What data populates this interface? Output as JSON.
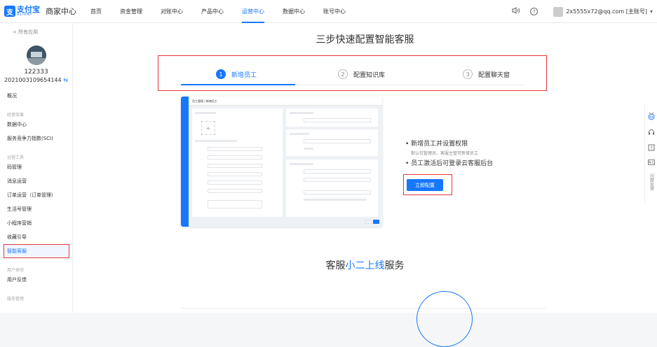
{
  "topbar": {
    "logo_mark": "支",
    "logo_name": "支付宝",
    "logo_sub": "ALIPAY",
    "app_title": "商家中心",
    "nav": [
      "首页",
      "资金管理",
      "对账中心",
      "产品中心",
      "运营中心",
      "数据中心",
      "账号中心"
    ],
    "active_nav": "运营中心",
    "user_label": "2x5555x72@qq.com [主账号]",
    "caret": "▾"
  },
  "sidebar": {
    "back_label": "< 所有应用",
    "account_name": "122333",
    "account_id": "2021003109654144",
    "swap_icon": "⇆",
    "items": [
      {
        "type": "item",
        "label": "概况"
      },
      {
        "type": "group",
        "label": "经营效果"
      },
      {
        "type": "item",
        "label": "数据中心"
      },
      {
        "type": "item",
        "label": "服务竞争力指数(SCI)"
      },
      {
        "type": "group",
        "label": "运营工具"
      },
      {
        "type": "item",
        "label": "码管理"
      },
      {
        "type": "item",
        "label": "消息运营"
      },
      {
        "type": "item",
        "label": "订单运营（订单管理）"
      },
      {
        "type": "item",
        "label": "生活号管理"
      },
      {
        "type": "item",
        "label": "小程序营销"
      },
      {
        "type": "item",
        "label": "收藏引导"
      },
      {
        "type": "item",
        "label": "智能客服",
        "active": true
      },
      {
        "type": "group",
        "label": "用户体验"
      },
      {
        "type": "item",
        "label": "用户反馈"
      },
      {
        "type": "group",
        "label": "服务管理"
      }
    ]
  },
  "main": {
    "title": "三步快速配置智能客服",
    "steps": [
      {
        "num": "1",
        "label": "新增员工",
        "active": true
      },
      {
        "num": "2",
        "label": "配置知识库",
        "active": false
      },
      {
        "num": "3",
        "label": "配置聊天窗",
        "active": false
      }
    ],
    "preview_breadcrumb": "员工管理 / 新增员工",
    "bullet_1": "• 新增员工并设置权限",
    "bullet_1_sub": "默认仅管理员、客服主管可新增员工",
    "bullet_2": "• 员工激活后可登录云客服后台",
    "config_button": "立即配置",
    "section2_prefix": "客服",
    "section2_highlight": "小二上线",
    "section2_suffix": "服务"
  },
  "float_bar": {
    "feedback_text": "问题反馈"
  },
  "colors": {
    "accent": "#1677ff",
    "highlight_border": "#e4393c"
  }
}
